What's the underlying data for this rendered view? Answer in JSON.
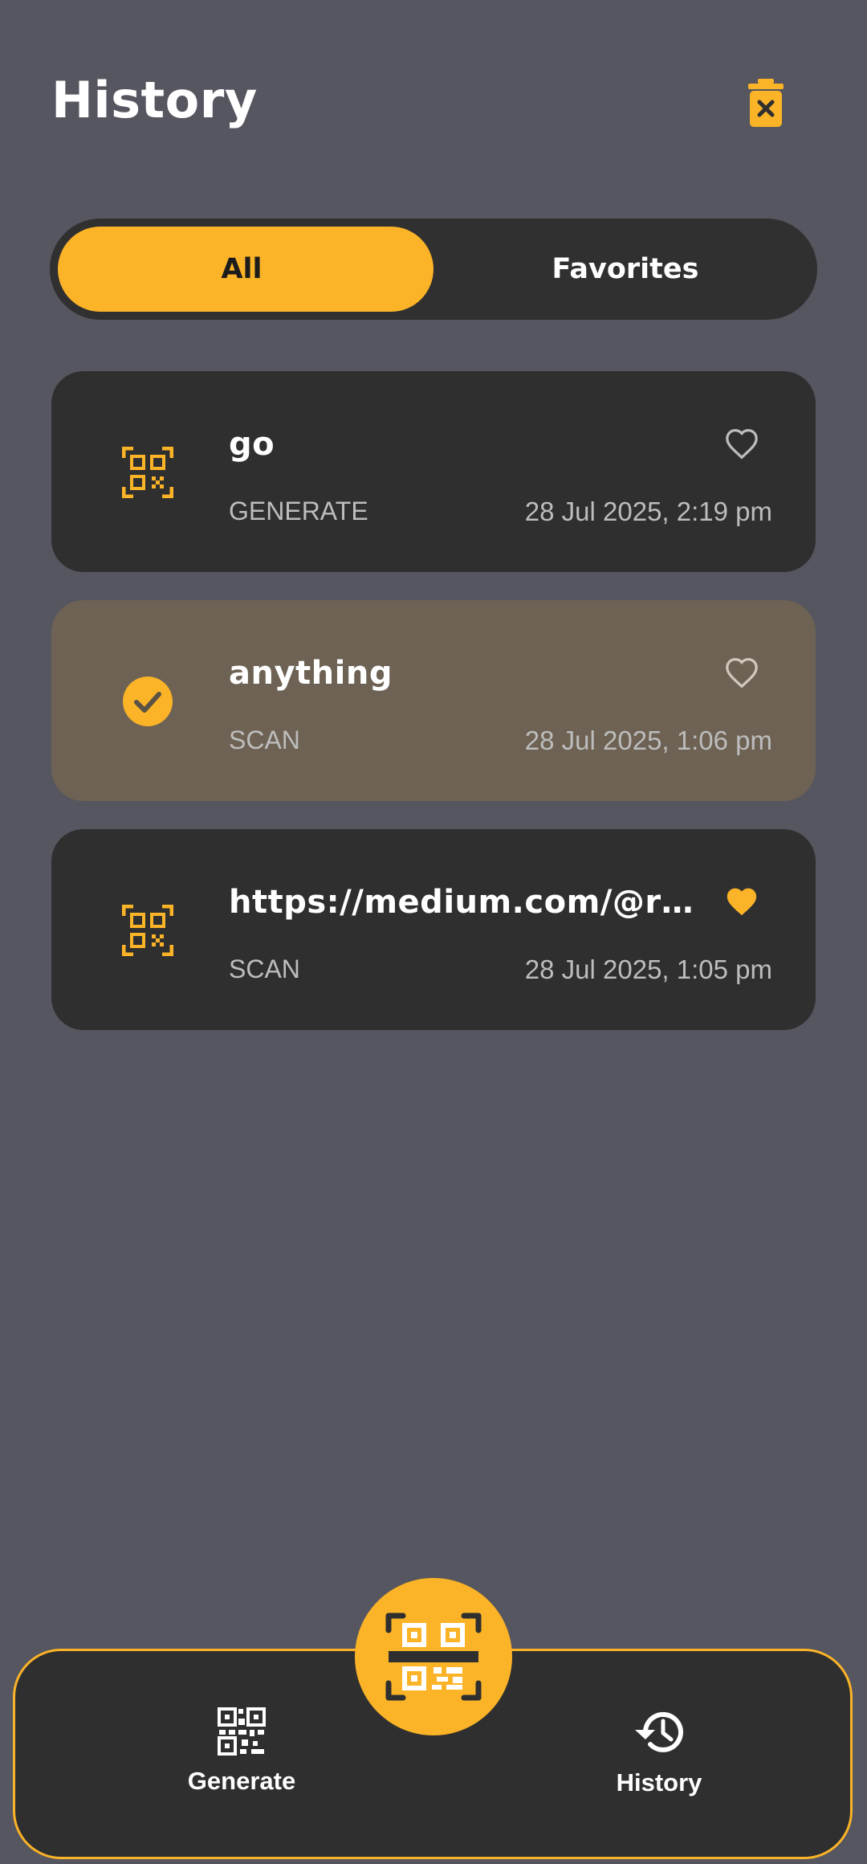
{
  "header": {
    "title": "History"
  },
  "filter": {
    "all_label": "All",
    "favorites_label": "Favorites",
    "selected": "All"
  },
  "history": [
    {
      "name": "go",
      "kind": "GENERATE",
      "date": "28 Jul 2025, 2:19 pm",
      "favorite": false,
      "selected": false,
      "icon": "qr-code-icon"
    },
    {
      "name": "anything",
      "kind": "SCAN",
      "date": "28 Jul 2025, 1:06 pm",
      "favorite": false,
      "selected": true,
      "icon": "check-circle-icon"
    },
    {
      "name": "https://medium.com/@rahul_dubey",
      "kind": "SCAN",
      "date": "28 Jul 2025, 1:05 pm",
      "favorite": true,
      "selected": false,
      "icon": "qr-code-icon"
    }
  ],
  "nav": {
    "generate_label": "Generate",
    "history_label": "History"
  },
  "colors": {
    "accent": "#fbb327",
    "background": "#55565f",
    "card": "#2f2f2f",
    "card_selected": "#6d6253"
  }
}
